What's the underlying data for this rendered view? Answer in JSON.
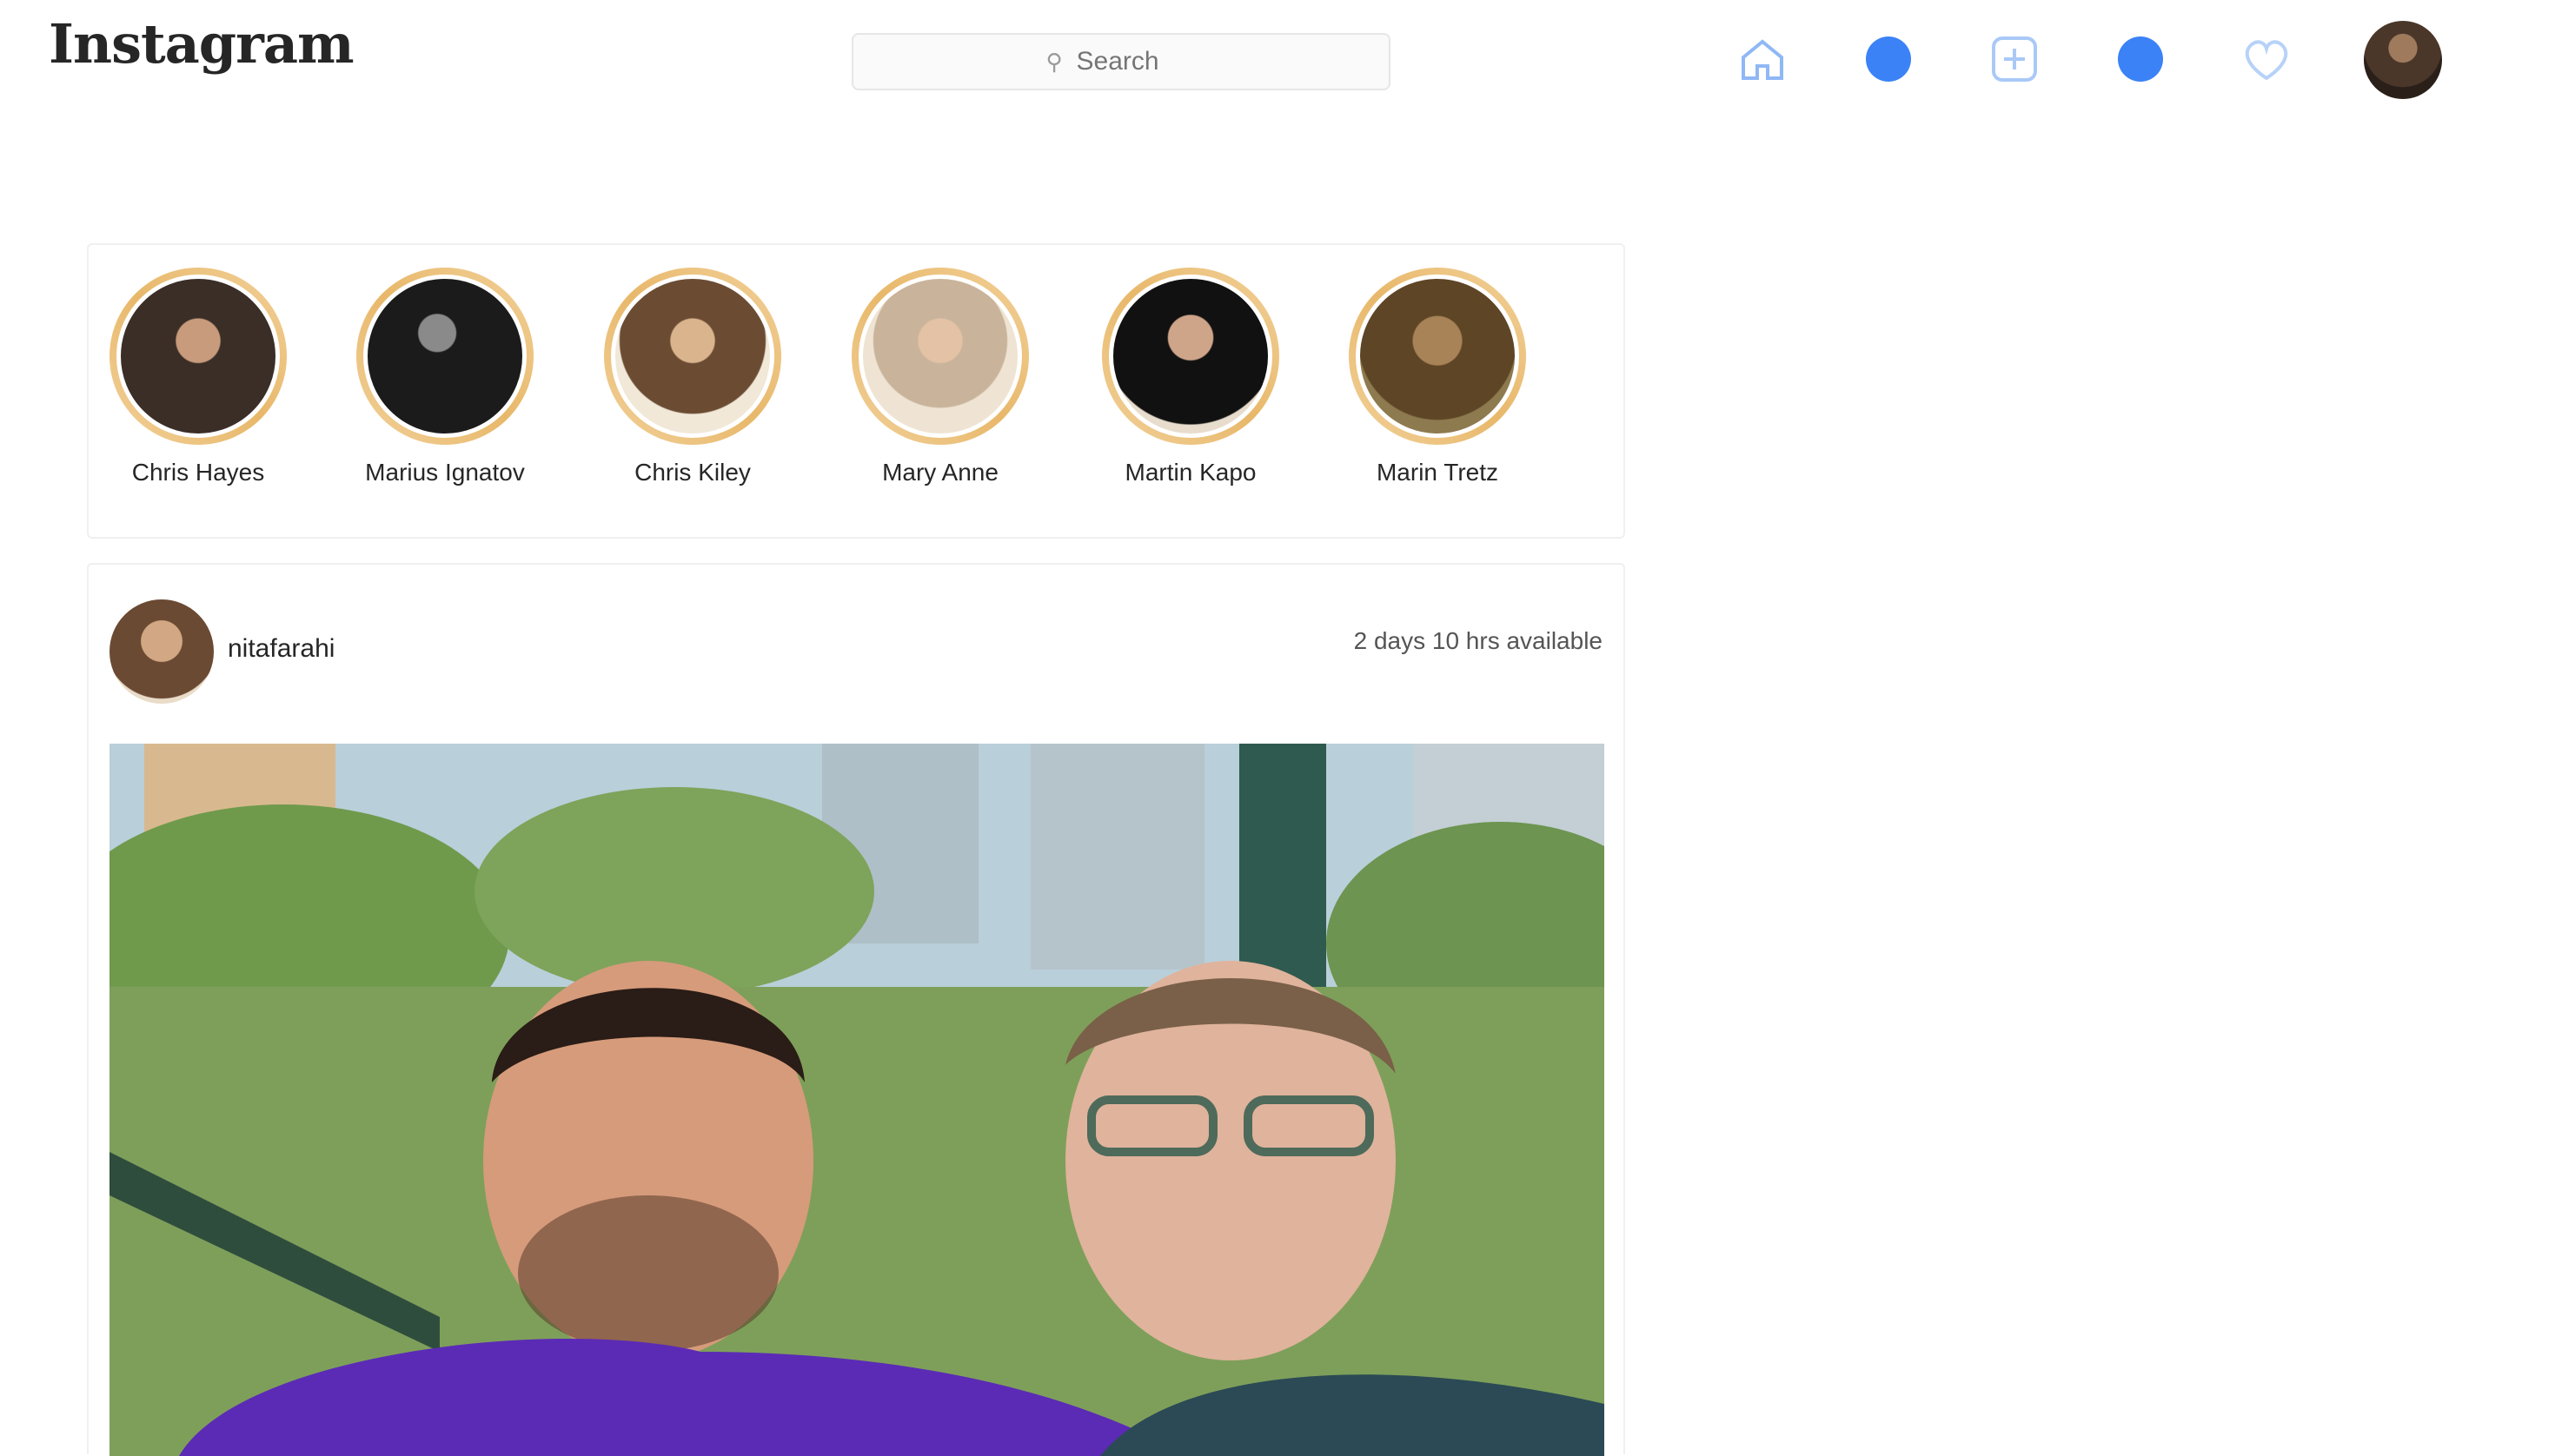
{
  "app": {
    "logo": "Instagram"
  },
  "search": {
    "placeholder": "Search"
  },
  "nav": {
    "icons": [
      "home-icon",
      "messages-icon",
      "new-post-icon",
      "explore-icon",
      "activity-icon"
    ],
    "accent": "#3b82f6"
  },
  "stories": [
    {
      "name": "Chris Hayes"
    },
    {
      "name": "Marius Ignatov"
    },
    {
      "name": "Chris Kiley"
    },
    {
      "name": "Mary Anne"
    },
    {
      "name": "Martin Kapo"
    },
    {
      "name": "Marin Tretz"
    }
  ],
  "post": {
    "username": "nitafarahi",
    "meta": "2 days 10 hrs available"
  },
  "colors": {
    "story_ring": "#e8b86a",
    "border": "#f0f0f0",
    "shirt_left": "#5b2bb5",
    "shirt_right": "#2b4a55"
  }
}
